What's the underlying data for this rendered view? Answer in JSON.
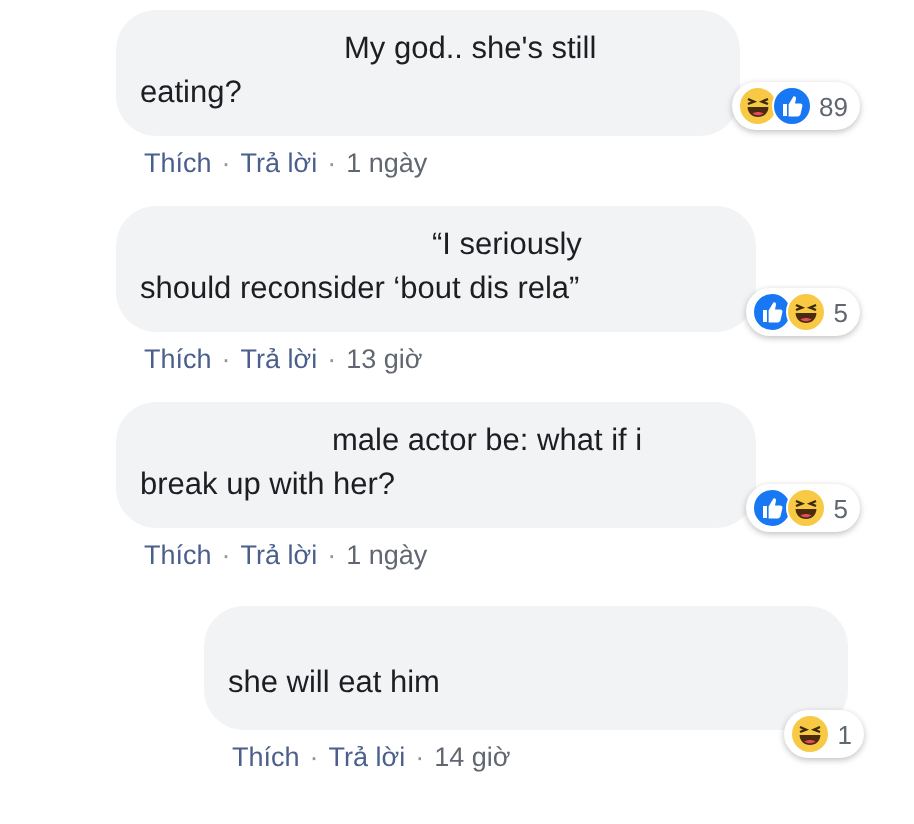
{
  "comments": [
    {
      "kind": "comment",
      "text": "My god.. she's still eating?",
      "reactions": [
        {
          "kind": "haha"
        },
        {
          "kind": "like"
        }
      ],
      "count": "89",
      "actions": [
        {
          "kind": "link",
          "text": "Thích"
        },
        {
          "kind": "separator",
          "text": "·"
        },
        {
          "kind": "link",
          "text": "Trả lời"
        },
        {
          "kind": "separator",
          "text": "·"
        },
        {
          "kind": "time",
          "text": "1 ngày"
        }
      ]
    },
    {
      "kind": "comment",
      "text": "“I seriously should reconsider ‘bout dis rela”",
      "reactions": [
        {
          "kind": "like"
        },
        {
          "kind": "haha"
        }
      ],
      "count": "5",
      "actions": [
        {
          "kind": "link",
          "text": "Thích"
        },
        {
          "kind": "separator",
          "text": "·"
        },
        {
          "kind": "link",
          "text": "Trả lời"
        },
        {
          "kind": "separator",
          "text": "·"
        },
        {
          "kind": "time",
          "text": "13 giờ"
        }
      ]
    },
    {
      "kind": "comment",
      "text": "male actor be: what if i break up with her?",
      "reactions": [
        {
          "kind": "like"
        },
        {
          "kind": "haha"
        }
      ],
      "count": "5",
      "actions": [
        {
          "kind": "link",
          "text": "Thích"
        },
        {
          "kind": "separator",
          "text": "·"
        },
        {
          "kind": "link",
          "text": "Trả lời"
        },
        {
          "kind": "separator",
          "text": "·"
        },
        {
          "kind": "time",
          "text": "1 ngày"
        }
      ]
    },
    {
      "kind": "reply",
      "text": "she will eat him",
      "reactions": [
        {
          "kind": "haha"
        }
      ],
      "count": "1",
      "actions": [
        {
          "kind": "link",
          "text": "Thích"
        },
        {
          "kind": "separator",
          "text": "·"
        },
        {
          "kind": "link",
          "text": "Trả lời"
        },
        {
          "kind": "separator",
          "text": "·"
        },
        {
          "kind": "time",
          "text": "14 giờ"
        }
      ]
    }
  ]
}
